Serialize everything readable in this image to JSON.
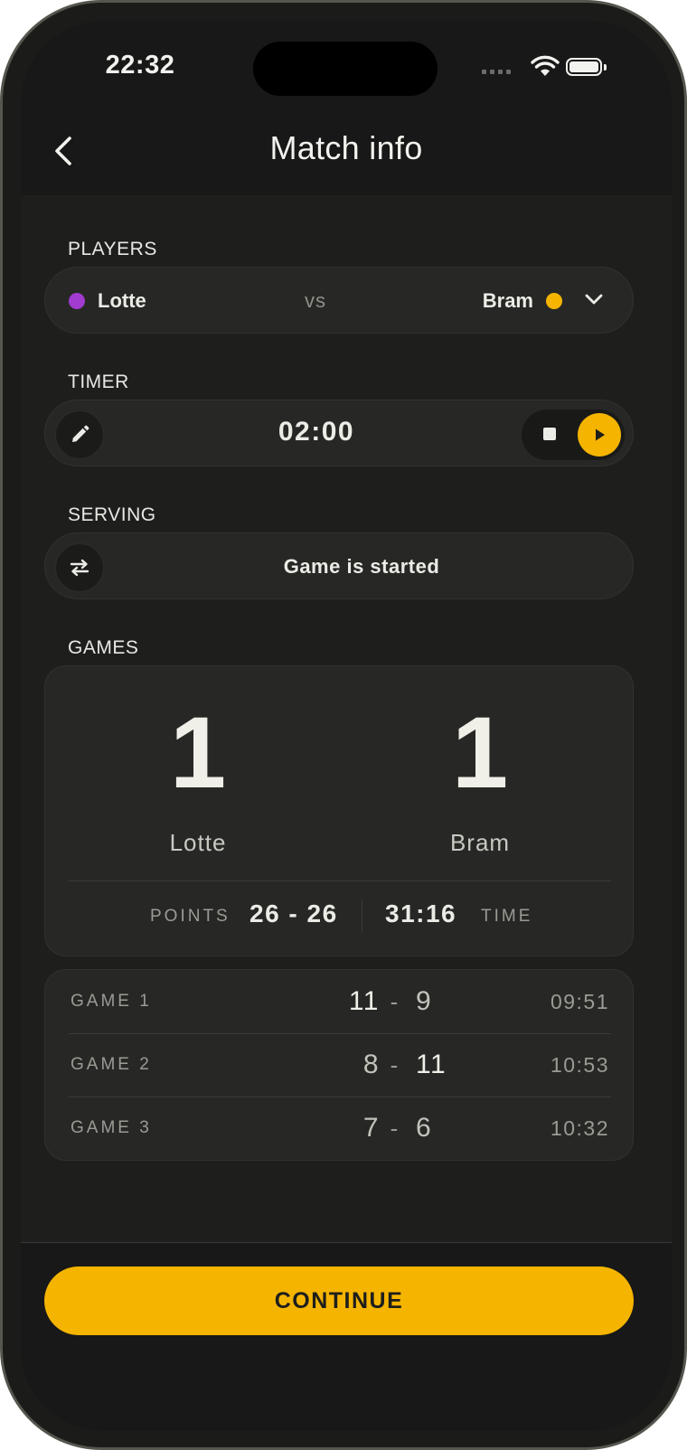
{
  "status_bar": {
    "time": "22:32"
  },
  "header": {
    "title": "Match info"
  },
  "players": {
    "label": "PLAYERS",
    "player1": {
      "name": "Lotte",
      "color": "#a23bd0"
    },
    "vs": "vs",
    "player2": {
      "name": "Bram",
      "color": "#f4b400"
    }
  },
  "timer": {
    "label": "TIMER",
    "value": "02:00"
  },
  "serving": {
    "label": "SERVING",
    "status": "Game is started"
  },
  "games": {
    "label": "GAMES",
    "score1": "1",
    "score2": "1",
    "name1": "Lotte",
    "name2": "Bram",
    "points_label": "POINTS",
    "points": "26 - 26",
    "time_label": "TIME",
    "time": "31:16",
    "rows": [
      {
        "label": "GAME 1",
        "a": "11",
        "dash": "-",
        "b": "9",
        "time": "09:51"
      },
      {
        "label": "GAME 2",
        "a": "8",
        "dash": "-",
        "b": "11",
        "time": "10:53"
      },
      {
        "label": "GAME 3",
        "a": "7",
        "dash": "-",
        "b": "6",
        "time": "10:32"
      }
    ]
  },
  "footer": {
    "continue_label": "CONTINUE"
  },
  "colors": {
    "accent": "#f4b400",
    "background": "#1e1f1d",
    "card": "#272825"
  }
}
